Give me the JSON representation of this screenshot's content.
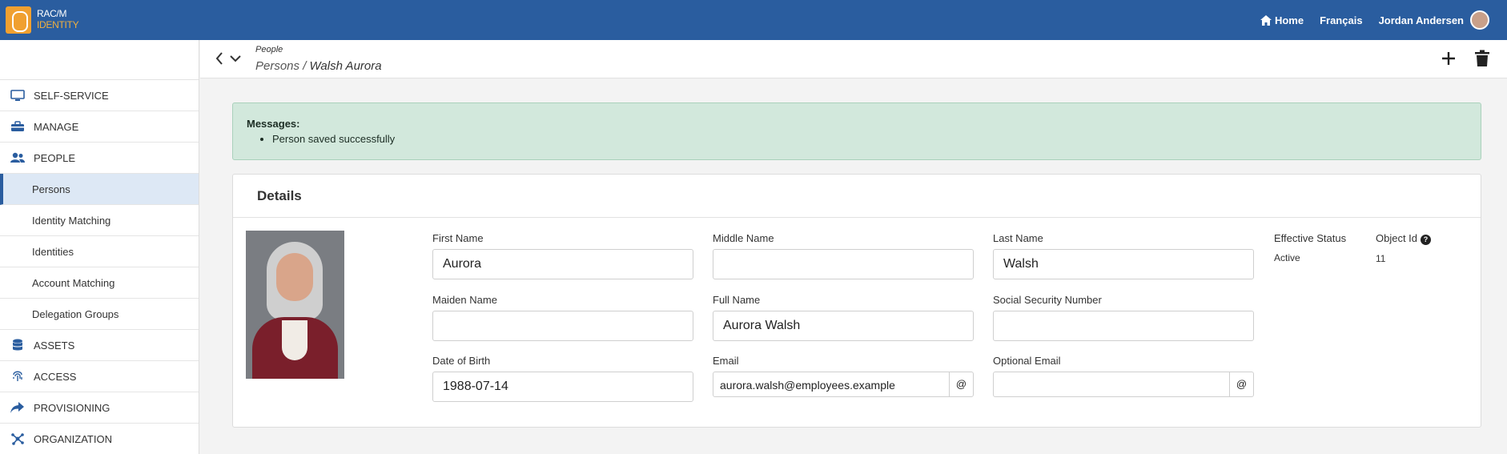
{
  "brand": {
    "line1": "RAC/M",
    "line2": "IDENTITY"
  },
  "topnav": {
    "home": "Home",
    "language": "Français",
    "user": "Jordan Andersen"
  },
  "sidebar": {
    "items": [
      {
        "label": "SELF-SERVICE",
        "type": "section",
        "icon": "monitor-icon"
      },
      {
        "label": "MANAGE",
        "type": "section",
        "icon": "toolbox-icon"
      },
      {
        "label": "PEOPLE",
        "type": "section",
        "icon": "users-icon"
      },
      {
        "label": "Persons",
        "type": "sub",
        "active": true
      },
      {
        "label": "Identity Matching",
        "type": "sub"
      },
      {
        "label": "Identities",
        "type": "sub"
      },
      {
        "label": "Account Matching",
        "type": "sub"
      },
      {
        "label": "Delegation Groups",
        "type": "sub"
      },
      {
        "label": "ASSETS",
        "type": "section",
        "icon": "database-icon"
      },
      {
        "label": "ACCESS",
        "type": "section",
        "icon": "fingerprint-icon"
      },
      {
        "label": "PROVISIONING",
        "type": "section",
        "icon": "share-icon"
      },
      {
        "label": "ORGANIZATION",
        "type": "section",
        "icon": "network-icon"
      }
    ]
  },
  "breadcrumb": {
    "section": "People",
    "parent": "Persons",
    "separator": " / ",
    "current": "Walsh Aurora"
  },
  "messages": {
    "title": "Messages:",
    "items": [
      "Person saved successfully"
    ]
  },
  "details": {
    "title": "Details",
    "fields": {
      "first_name": {
        "label": "First Name",
        "value": "Aurora"
      },
      "middle_name": {
        "label": "Middle Name",
        "value": ""
      },
      "last_name": {
        "label": "Last Name",
        "value": "Walsh"
      },
      "maiden_name": {
        "label": "Maiden Name",
        "value": ""
      },
      "full_name": {
        "label": "Full Name",
        "value": "Aurora Walsh"
      },
      "ssn": {
        "label": "Social Security Number",
        "value": ""
      },
      "dob": {
        "label": "Date of Birth",
        "value": "1988-07-14"
      },
      "email": {
        "label": "Email",
        "value": "aurora.walsh@employees.example",
        "addon": "@"
      },
      "optional_email": {
        "label": "Optional Email",
        "value": "",
        "addon": "@"
      }
    },
    "effective_status": {
      "label": "Effective Status",
      "value": "Active"
    },
    "object_id": {
      "label": "Object Id",
      "value": "11",
      "help": "?"
    }
  },
  "colors": {
    "topbar": "#2a5d9f",
    "accent": "#f0a030",
    "message_bg": "#d2e8dc"
  }
}
